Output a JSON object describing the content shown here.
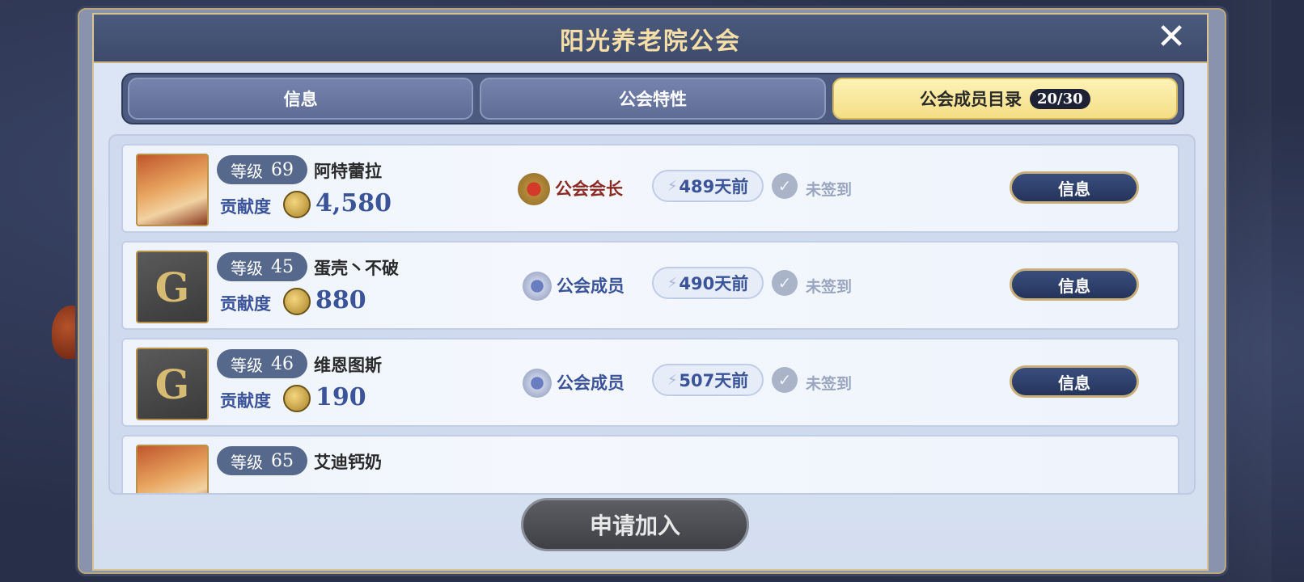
{
  "dialog": {
    "title": "阳光养老院公会",
    "close_symbol": "✕"
  },
  "tabs": [
    {
      "label": "信息",
      "active": false
    },
    {
      "label": "公会特性",
      "active": false
    },
    {
      "label": "公会成员目录",
      "active": true,
      "count": "20/30"
    }
  ],
  "members": [
    {
      "level_label": "等级",
      "level": "69",
      "name": "阿特蕾拉",
      "contrib_label": "贡献度",
      "contribution": "4,580",
      "role": "公会会长",
      "role_type": "leader",
      "last_seen": "489天前",
      "signin": "未签到",
      "info_button": "信息",
      "avatar": "portrait"
    },
    {
      "level_label": "等级",
      "level": "45",
      "name": "蛋壳丶不破",
      "contrib_label": "贡献度",
      "contribution": "880",
      "role": "公会成员",
      "role_type": "member",
      "last_seen": "490天前",
      "signin": "未签到",
      "info_button": "信息",
      "avatar": "guild"
    },
    {
      "level_label": "等级",
      "level": "46",
      "name": "维恩图斯",
      "contrib_label": "贡献度",
      "contribution": "190",
      "role": "公会成员",
      "role_type": "member",
      "last_seen": "507天前",
      "signin": "未签到",
      "info_button": "信息",
      "avatar": "guild"
    },
    {
      "level_label": "等级",
      "level": "65",
      "name": "艾迪钙奶",
      "avatar": "portrait"
    }
  ],
  "guild_avatar_letter": "G",
  "join_button": "申请加入",
  "icons": {
    "coin": "coin-icon",
    "bolt": "⚡",
    "check": "✓"
  },
  "colors": {
    "accent_gold": "#f5dfa6",
    "active_tab": "#f4de86",
    "leader_red": "#8a2a22",
    "member_blue": "#3b5499"
  }
}
